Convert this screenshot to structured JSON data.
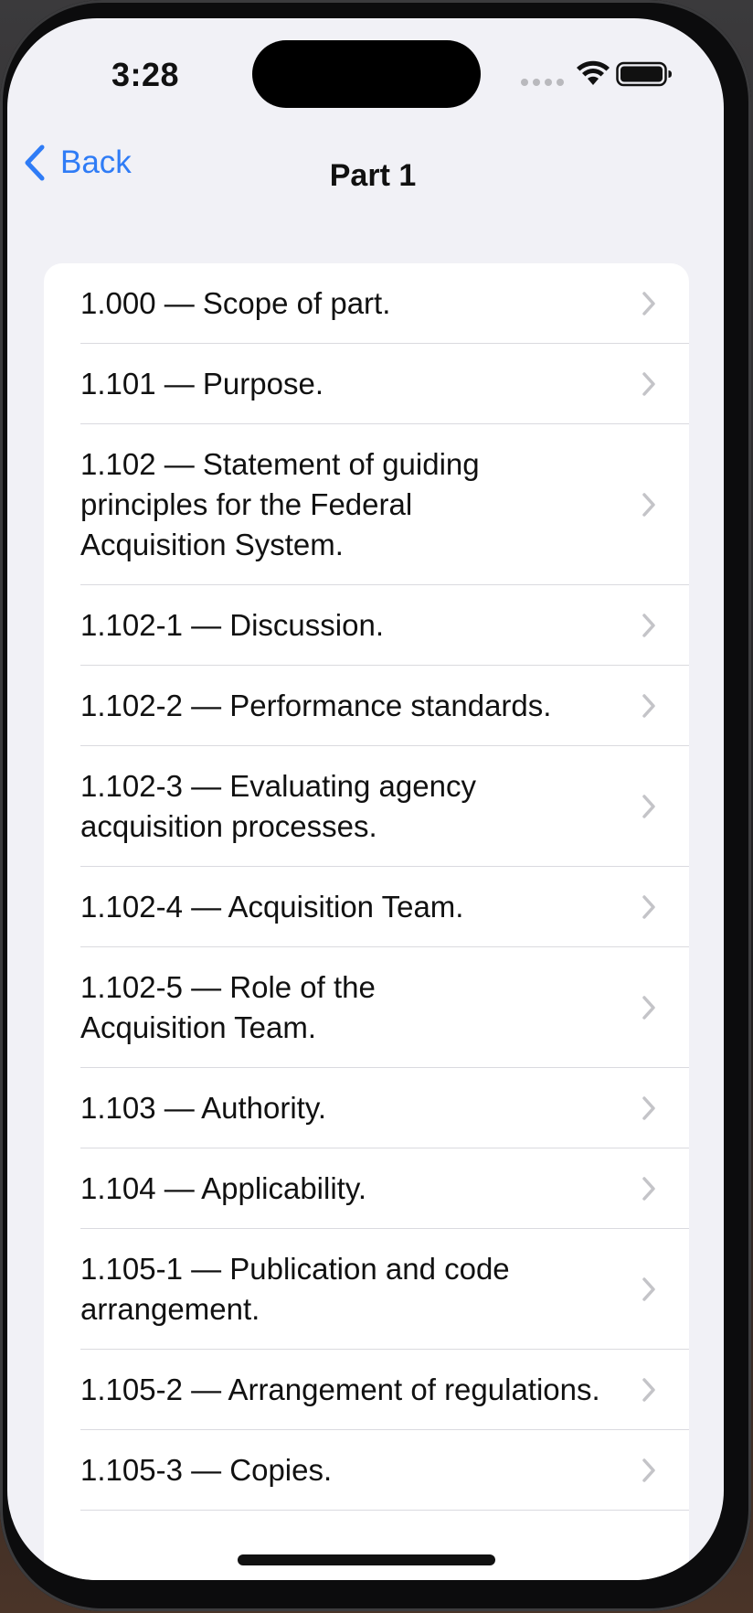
{
  "status_bar": {
    "time": "3:28"
  },
  "nav": {
    "back_label": "Back",
    "title": "Part 1"
  },
  "sections": [
    {
      "label": "1.000 — Scope of part."
    },
    {
      "label": "1.101 — Purpose."
    },
    {
      "label": "1.102 — Statement of guiding principles for the Federal Acquisition System."
    },
    {
      "label": "1.102-1 — Discussion."
    },
    {
      "label": "1.102-2 — Performance standards."
    },
    {
      "label": "1.102-3 — Evaluating agency acquisition processes."
    },
    {
      "label": "1.102-4 — Acquisition Team."
    },
    {
      "label": "1.102-5 — Role of the Acquisition Team."
    },
    {
      "label": "1.103 — Authority."
    },
    {
      "label": "1.104 — Applicability."
    },
    {
      "label": "1.105-1 — Publication and code arrangement."
    },
    {
      "label": "1.105-2 — Arrangement of regulations."
    },
    {
      "label": "1.105-3 — Copies."
    }
  ],
  "icons": {
    "back": "chevron-left-icon",
    "row_disclosure": "chevron-right-icon",
    "wifi": "wifi-icon",
    "battery": "battery-icon"
  },
  "colors": {
    "accent": "#2f7cf6",
    "background": "#f1f1f6",
    "card": "#ffffff",
    "separator": "#dadadf",
    "chevron": "#c4c4c8"
  }
}
